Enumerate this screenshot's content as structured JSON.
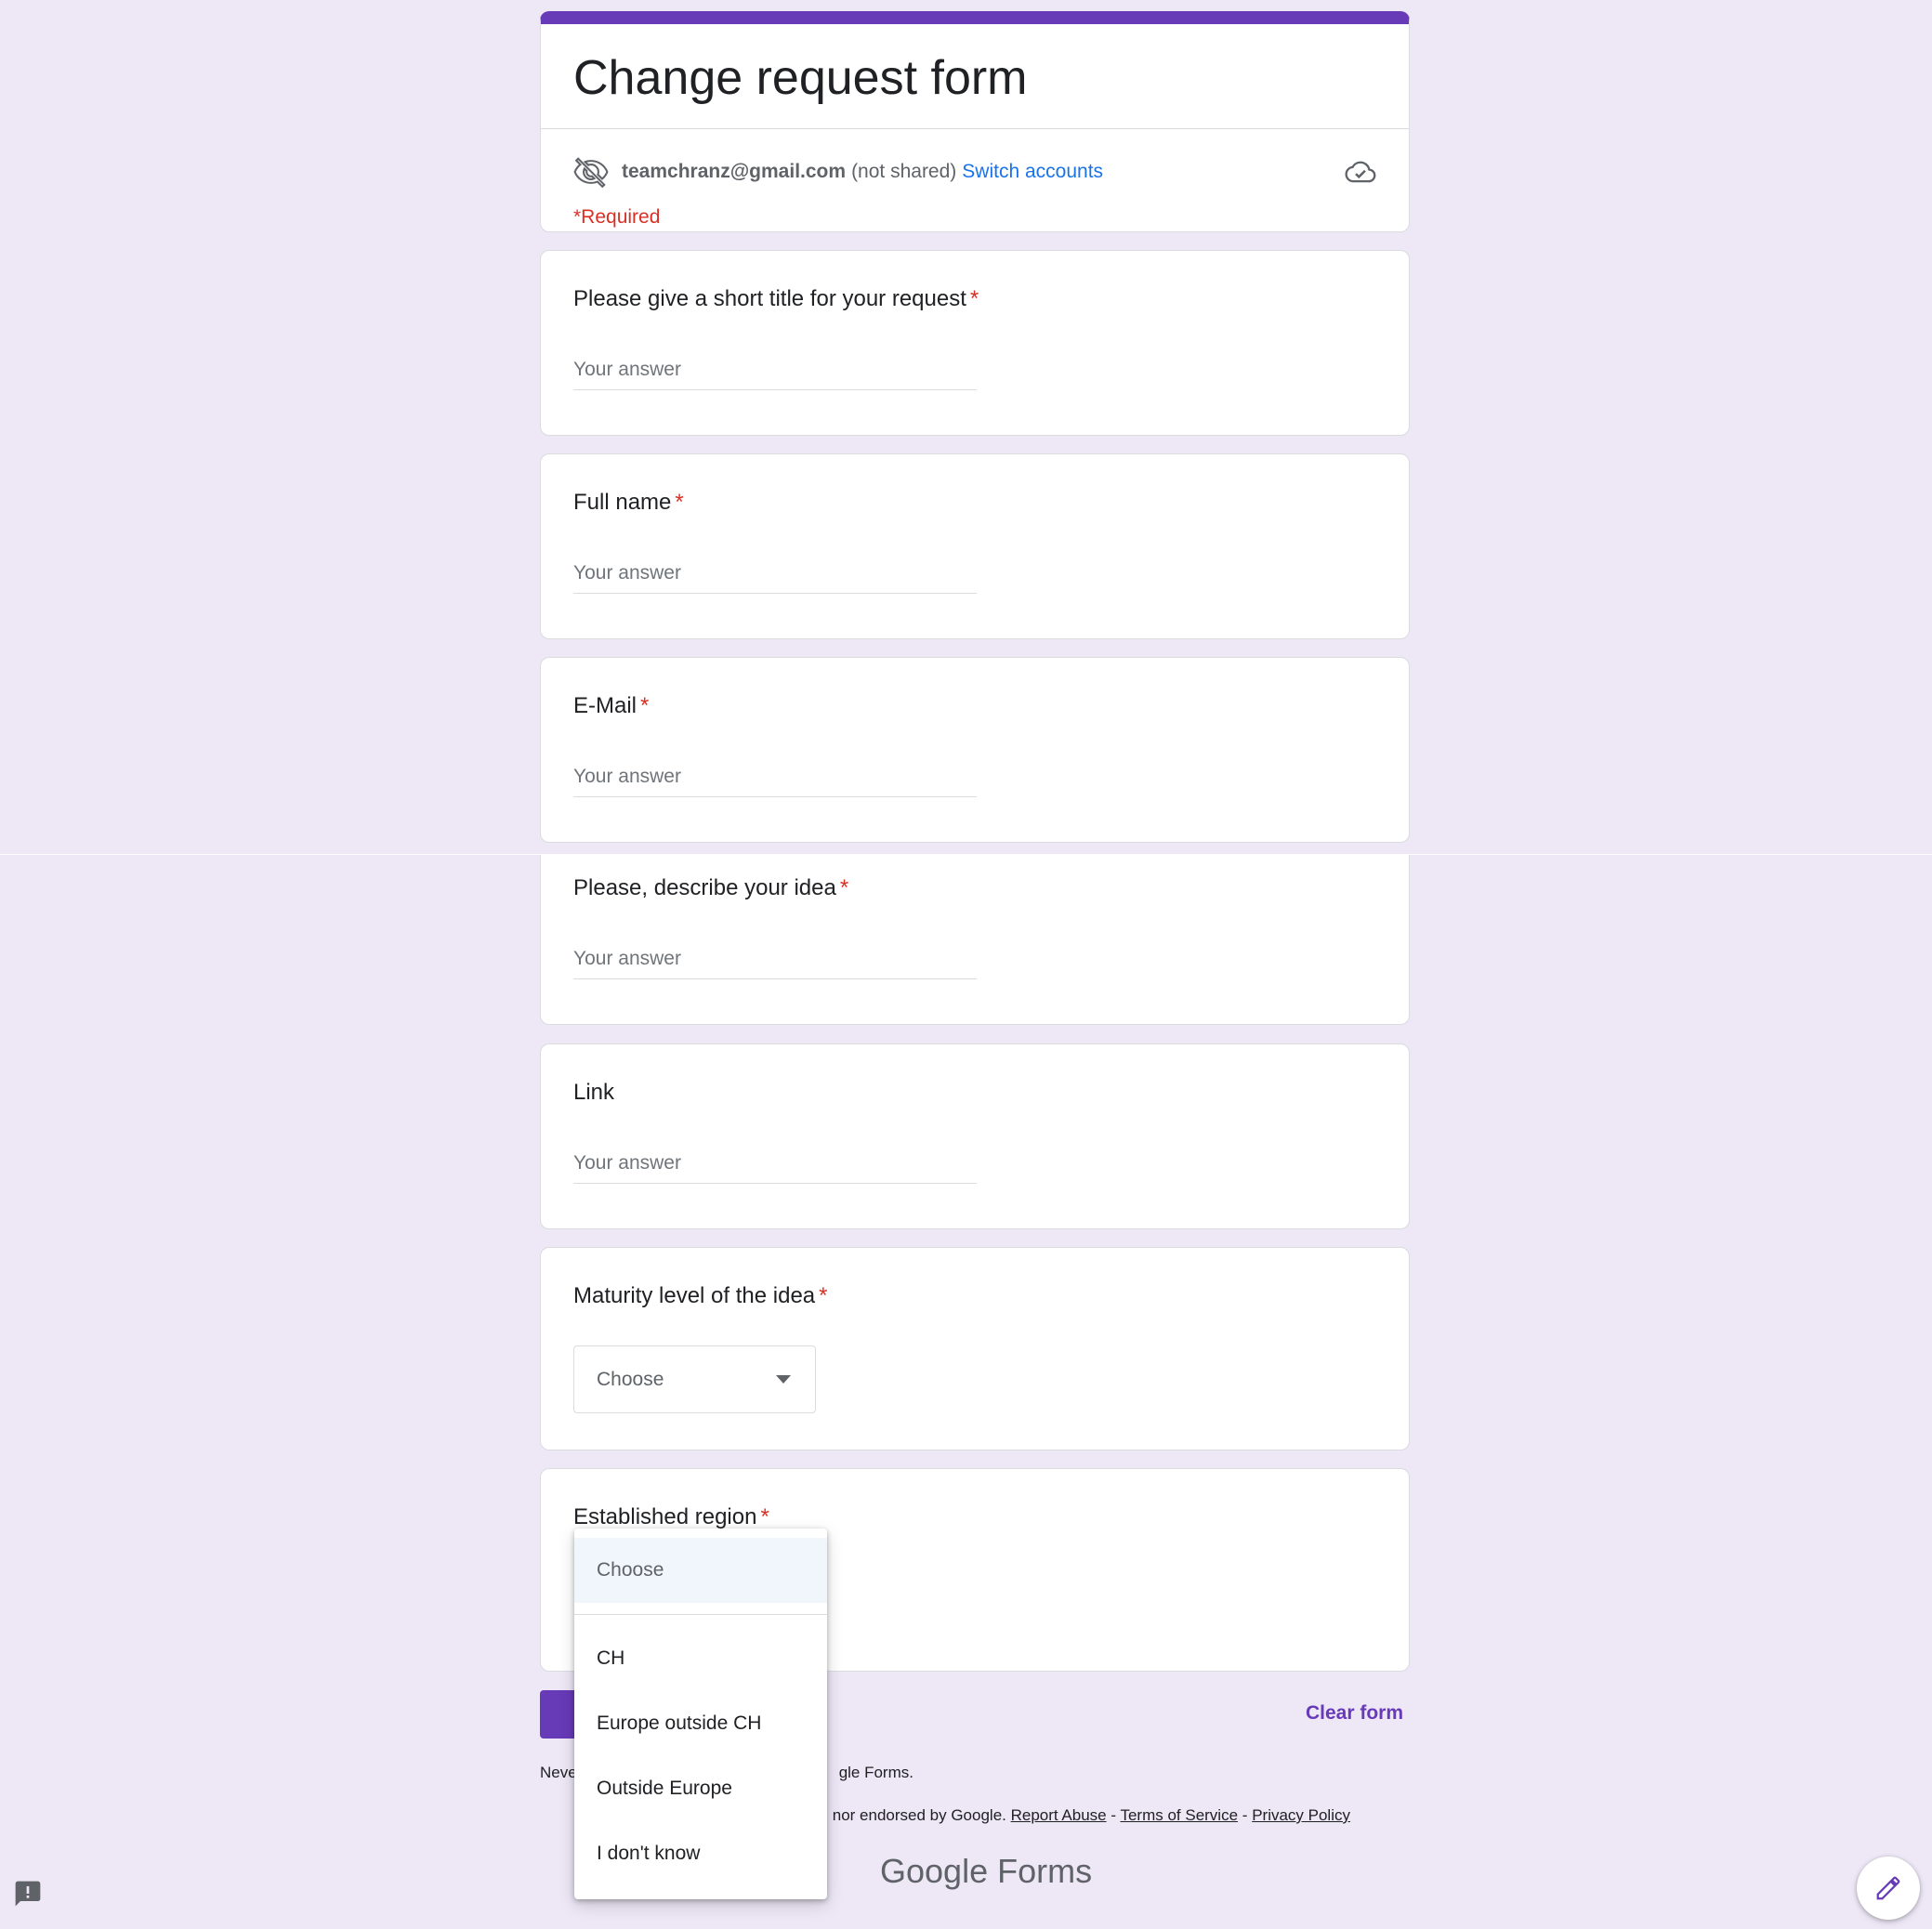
{
  "colors": {
    "accent": "#673ab7",
    "link": "#1a73e8",
    "required": "#d93025",
    "background": "#ede7f6"
  },
  "form": {
    "title": "Change request form",
    "account_email": "teamchranz@gmail.com",
    "account_shared": "(not shared)",
    "switch_accounts": "Switch accounts",
    "required_note": "*Required"
  },
  "questions": [
    {
      "label": "Please give a short title for your request",
      "required_mark": "*",
      "placeholder": "Your answer"
    },
    {
      "label": "Full name",
      "required_mark": "*",
      "placeholder": "Your answer"
    },
    {
      "label": "E-Mail",
      "required_mark": "*",
      "placeholder": "Your answer"
    },
    {
      "label": "Please, describe your idea",
      "required_mark": "*",
      "placeholder": "Your answer"
    },
    {
      "label": "Link",
      "required_mark": "",
      "placeholder": "Your answer"
    },
    {
      "label": "Maturity level of the idea",
      "required_mark": "*",
      "select_value": "Choose"
    },
    {
      "label": "Established region",
      "required_mark": "*"
    }
  ],
  "region_dropdown": {
    "options": [
      "Choose",
      "CH",
      "Europe outside CH",
      "Outside Europe",
      "I don't know"
    ],
    "selected": "Choose"
  },
  "actions": {
    "clear_form": "Clear form"
  },
  "footer": {
    "line1_start": "Neve",
    "line1_end": "gle Forms.",
    "line2_prefix": "nor endorsed by Google.",
    "report_abuse": "Report Abuse",
    "terms": "Terms of Service",
    "privacy": "Privacy Policy",
    "sep": "-",
    "logo_google": "Google",
    "logo_forms": "Forms"
  },
  "icons": {
    "visibility": "eye-off-icon",
    "cloud": "cloud-done-icon",
    "feedback": "feedback-icon",
    "edit": "pencil-icon"
  }
}
